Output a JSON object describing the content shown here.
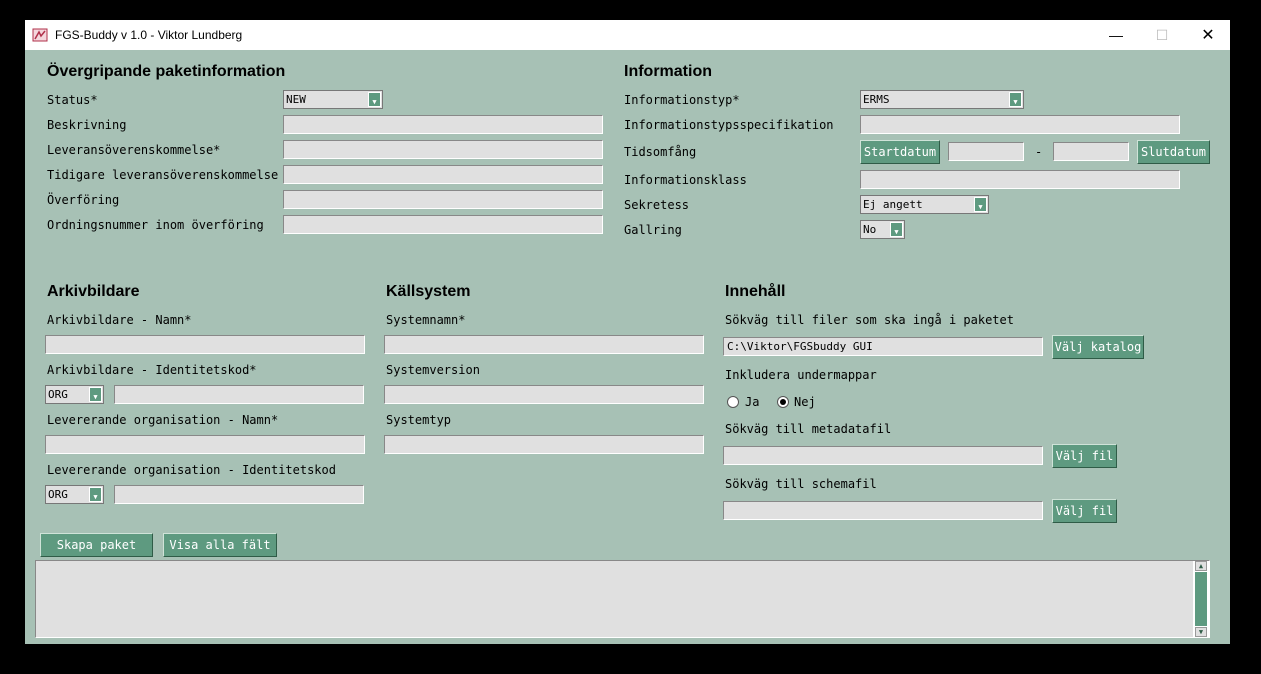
{
  "window": {
    "title": "FGS-Buddy v 1.0 - Viktor Lundberg",
    "min_glyph": "—",
    "max_glyph": "☐",
    "close_glyph": "✕"
  },
  "package": {
    "header": "Övergripande paketinformation",
    "status_label": "Status*",
    "status_value": "NEW",
    "desc_label": "Beskrivning",
    "desc_value": "",
    "agreement_label": "Leveransöverenskommelse*",
    "agreement_value": "",
    "prev_agreement_label": "Tidigare leveransöverenskommelse",
    "prev_agreement_value": "",
    "transfer_label": "Överföring",
    "transfer_value": "",
    "order_label": "Ordningsnummer inom överföring",
    "order_value": ""
  },
  "information": {
    "header": "Information",
    "type_label": "Informationstyp*",
    "type_value": "ERMS",
    "spec_label": "Informationstypsspecifikation",
    "spec_value": "",
    "range_label": "Tidsomfång",
    "start_button": "Startdatum",
    "start_value": "",
    "dash": "-",
    "end_value": "",
    "end_button": "Slutdatum",
    "class_label": "Informationsklass",
    "class_value": "",
    "secrecy_label": "Sekretess",
    "secrecy_value": "Ej angett",
    "culling_label": "Gallring",
    "culling_value": "No"
  },
  "archive": {
    "header": "Arkivbildare",
    "name_label": "Arkivbildare - Namn*",
    "name_value": "",
    "id_label": "Arkivbildare - Identitetskod*",
    "id_type": "ORG",
    "id_value": "",
    "org_name_label": "Levererande organisation - Namn*",
    "org_name_value": "",
    "org_id_label": "Levererande organisation - Identitetskod",
    "org_id_type": "ORG",
    "org_id_value": ""
  },
  "source": {
    "header": "Källsystem",
    "name_label": "Systemnamn*",
    "name_value": "",
    "version_label": "Systemversion",
    "version_value": "",
    "type_label": "Systemtyp",
    "type_value": ""
  },
  "content": {
    "header": "Innehåll",
    "path_label": "Sökväg till filer som ska ingå i paketet",
    "path_value": "C:\\Viktor\\FGSbuddy GUI",
    "path_button": "Välj katalog",
    "subfolders_label": "Inkludera undermappar",
    "yes_label": "Ja",
    "no_label": "Nej",
    "subfolders_selected": "Nej",
    "meta_label": "Sökväg till metadatafil",
    "meta_value": "",
    "meta_button": "Välj fil",
    "schema_label": "Sökväg till schemafil",
    "schema_value": "",
    "schema_button": "Välj fil"
  },
  "actions": {
    "create": "Skapa paket",
    "show_all": "Visa alla fält"
  },
  "log": {
    "text": ""
  },
  "icons": {
    "app": "app-logo-icon",
    "dropdown": "chevron-down-icon"
  },
  "colors": {
    "background": "#a7c1b5",
    "button": "#5e9a80",
    "field": "#e0e0e0"
  }
}
